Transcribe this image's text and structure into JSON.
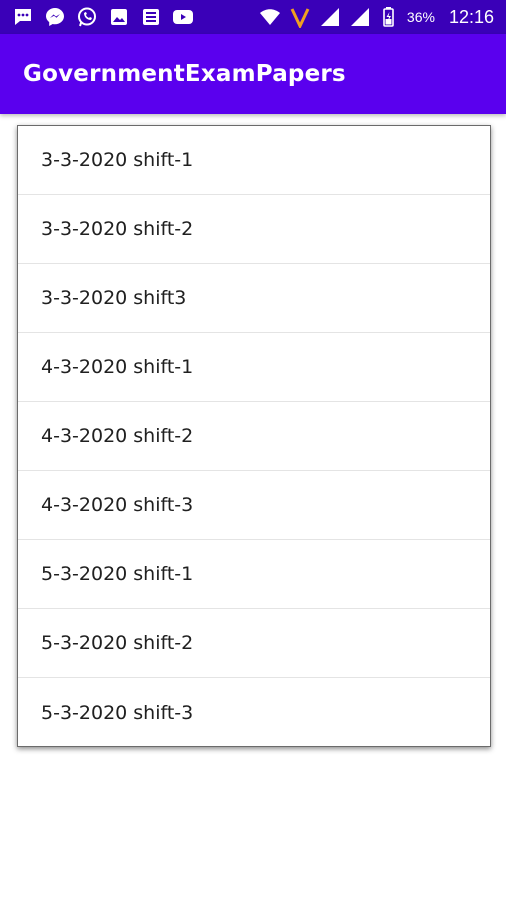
{
  "status_bar": {
    "battery_percent": "36%",
    "time": "12:16",
    "icons_left": [
      "messages-icon",
      "messenger-icon",
      "whatsapp-icon",
      "gallery-icon",
      "news-icon",
      "youtube-icon"
    ],
    "icons_right": [
      "wifi-icon",
      "v-app-icon",
      "signal-icon",
      "signal-icon",
      "battery-icon"
    ]
  },
  "app_bar": {
    "title": "GovernmentExamPapers",
    "color": "#5a00ee"
  },
  "list": {
    "items": [
      {
        "label": "3-3-2020 shift-1"
      },
      {
        "label": "3-3-2020 shift-2"
      },
      {
        "label": "3-3-2020 shift3"
      },
      {
        "label": "4-3-2020 shift-1"
      },
      {
        "label": "4-3-2020 shift-2"
      },
      {
        "label": "4-3-2020 shift-3"
      },
      {
        "label": "5-3-2020 shift-1"
      },
      {
        "label": "5-3-2020 shift-2"
      },
      {
        "label": "5-3-2020 shift-3"
      }
    ]
  }
}
